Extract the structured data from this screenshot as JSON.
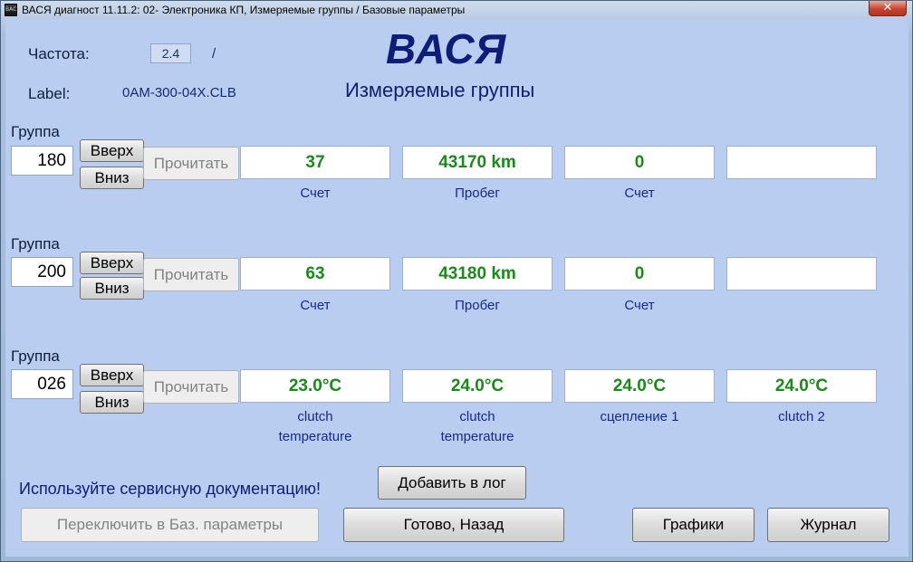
{
  "window": {
    "title": "ВАСЯ диагност 11.11.2: 02- Электроника КП,  Измеряемые группы / Базовые параметры",
    "icon_text": "ВАСЯ",
    "close_glyph": "✕"
  },
  "header": {
    "freq_label": "Частота:",
    "freq_value": "2.4",
    "freq_separator": "/",
    "label_label": "Label:",
    "label_value": "0AM-300-04X.CLB",
    "logo": "ВАСЯ",
    "subtitle": "Измеряемые группы"
  },
  "groups": [
    {
      "label": "Группа",
      "number": "180",
      "up": "Вверх",
      "down": "Вниз",
      "read": "Прочитать",
      "fields": [
        {
          "value": "37",
          "unit": "Счет"
        },
        {
          "value": "43170 km",
          "unit": "Пробег"
        },
        {
          "value": "0",
          "unit": "Счет"
        },
        {
          "value": "",
          "unit": ""
        }
      ]
    },
    {
      "label": "Группа",
      "number": "200",
      "up": "Вверх",
      "down": "Вниз",
      "read": "Прочитать",
      "fields": [
        {
          "value": "63",
          "unit": "Счет"
        },
        {
          "value": "43180 km",
          "unit": "Пробег"
        },
        {
          "value": "0",
          "unit": "Счет"
        },
        {
          "value": "",
          "unit": ""
        }
      ]
    },
    {
      "label": "Группа",
      "number": "026",
      "up": "Вверх",
      "down": "Вниз",
      "read": "Прочитать",
      "fields": [
        {
          "value": "23.0°C",
          "unit": "clutch",
          "unit2": "temperature"
        },
        {
          "value": "24.0°C",
          "unit": "clutch",
          "unit2": "temperature"
        },
        {
          "value": "24.0°C",
          "unit": "сцепление 1"
        },
        {
          "value": "24.0°C",
          "unit": "clutch 2"
        }
      ]
    }
  ],
  "footer": {
    "note": "Используйте сервисную документацию!",
    "add_log": "Добавить в лог",
    "switch_basic": "Переключить в Баз. параметры",
    "done_back": "Готово, Назад",
    "graphs": "Графики",
    "journal": "Журнал"
  }
}
